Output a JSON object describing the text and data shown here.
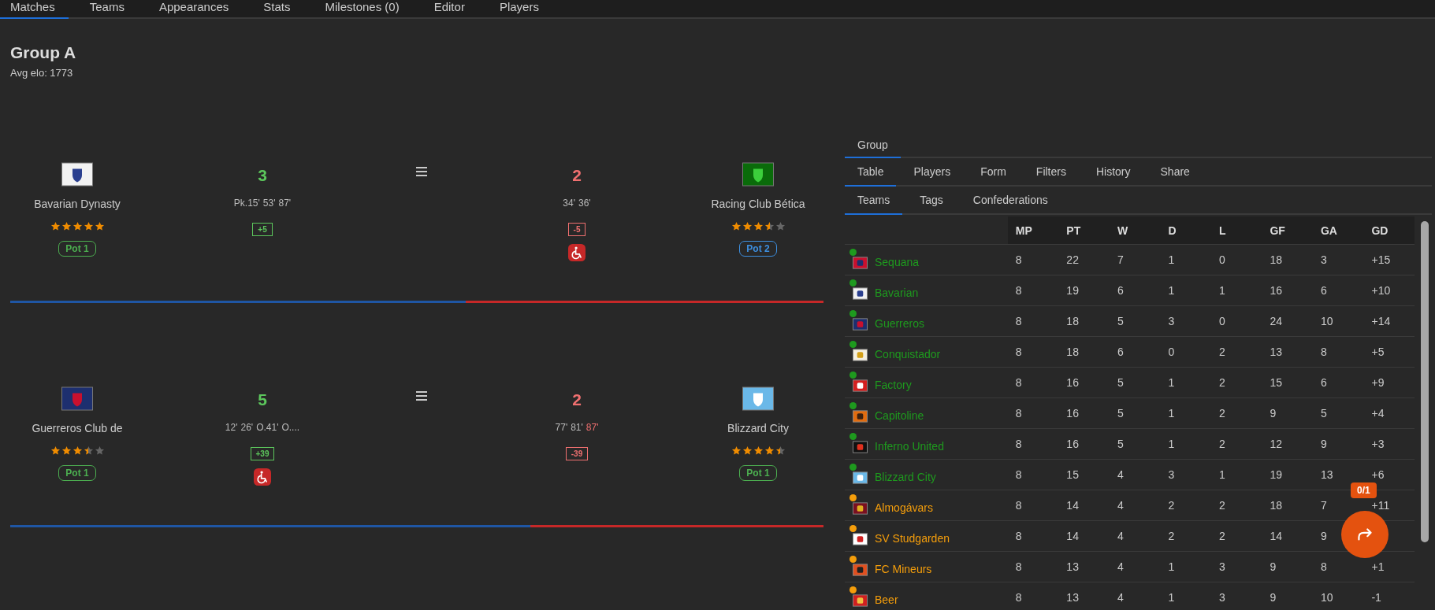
{
  "nav_tabs": [
    {
      "label": "Matches",
      "selected": true
    },
    {
      "label": "Teams",
      "selected": false
    },
    {
      "label": "Appearances",
      "selected": false
    },
    {
      "label": "Stats",
      "selected": false
    },
    {
      "label": "Milestones (0)",
      "selected": false
    },
    {
      "label": "Editor",
      "selected": false
    },
    {
      "label": "Players",
      "selected": false
    }
  ],
  "group": {
    "title": "Group A",
    "subtitle": "Avg elo: 1773"
  },
  "matches": [
    {
      "home": {
        "name": "Bavarian Dynasty",
        "stars": 5,
        "pot": "Pot 1",
        "color": "#4caf50",
        "score": "3",
        "goals": [
          {
            "text": "Pk.15'",
            "highlighted": false
          },
          {
            "text": "53'",
            "highlighted": false
          },
          {
            "text": "87'",
            "highlighted": false
          }
        ],
        "diff": "+5",
        "winner": true,
        "accessibility_badge": false
      },
      "away": {
        "name": "Racing Club Bética",
        "stars": 3.5,
        "pot": "Pot 2",
        "color": "#3d8fe0",
        "score": "2",
        "goals": [
          {
            "text": "34'",
            "highlighted": false
          },
          {
            "text": "36'",
            "highlighted": false
          }
        ],
        "diff": "-5",
        "winner": false,
        "accessibility_badge": true
      },
      "level": 0.56
    },
    {
      "home": {
        "name": "Guerreros Club de",
        "stars": 3.5,
        "pot": "Pot 1",
        "color": "#4caf50",
        "score": "5",
        "goals": [
          {
            "text": "12'",
            "highlighted": false
          },
          {
            "text": "26'",
            "highlighted": false
          },
          {
            "text": "O.41'",
            "highlighted": false
          },
          {
            "text": "O....",
            "highlighted": false
          }
        ],
        "diff": "+39",
        "winner": true,
        "accessibility_badge": true
      },
      "away": {
        "name": "Blizzard City",
        "stars": 4.5,
        "pot": "Pot 1",
        "color": "#4caf50",
        "score": "2",
        "goals": [
          {
            "text": "77'",
            "highlighted": false
          },
          {
            "text": "81'",
            "highlighted": false
          },
          {
            "text": "87'",
            "highlighted": true
          }
        ],
        "diff": "-39",
        "winner": false,
        "accessibility_badge": false
      },
      "level": 0.64
    }
  ],
  "panel_tabs": [
    {
      "label": "Group",
      "selected": true
    }
  ],
  "view_tabs": [
    {
      "label": "Table",
      "selected": true
    },
    {
      "label": "Players",
      "selected": false
    },
    {
      "label": "Form",
      "selected": false
    },
    {
      "label": "Filters",
      "selected": false
    },
    {
      "label": "History",
      "selected": false
    },
    {
      "label": "Share",
      "selected": false
    }
  ],
  "table_tabs": [
    {
      "label": "Teams",
      "selected": true
    },
    {
      "label": "Tags",
      "selected": false
    },
    {
      "label": "Confederations",
      "selected": false
    }
  ],
  "table": {
    "columns": [
      "MP",
      "PT",
      "W",
      "D",
      "L",
      "GF",
      "GA",
      "GD"
    ],
    "rows": [
      {
        "team": "Sequana",
        "color": "#1e9a1e",
        "cells": [
          "8",
          "22",
          "7",
          "1",
          "0",
          "18",
          "3",
          "+15"
        ]
      },
      {
        "team": "Bavarian",
        "color": "#1e9a1e",
        "cells": [
          "8",
          "19",
          "6",
          "1",
          "1",
          "16",
          "6",
          "+10"
        ]
      },
      {
        "team": "Guerreros",
        "color": "#1e9a1e",
        "cells": [
          "8",
          "18",
          "5",
          "3",
          "0",
          "24",
          "10",
          "+14"
        ]
      },
      {
        "team": "Conquistador",
        "color": "#1e9a1e",
        "cells": [
          "8",
          "18",
          "6",
          "0",
          "2",
          "13",
          "8",
          "+5"
        ]
      },
      {
        "team": "Factory",
        "color": "#1e9a1e",
        "cells": [
          "8",
          "16",
          "5",
          "1",
          "2",
          "15",
          "6",
          "+9"
        ]
      },
      {
        "team": "Capitoline",
        "color": "#1e9a1e",
        "cells": [
          "8",
          "16",
          "5",
          "1",
          "2",
          "9",
          "5",
          "+4"
        ]
      },
      {
        "team": "Inferno United",
        "color": "#1e9a1e",
        "cells": [
          "8",
          "16",
          "5",
          "1",
          "2",
          "12",
          "9",
          "+3"
        ]
      },
      {
        "team": "Blizzard City",
        "color": "#1e9a1e",
        "cells": [
          "8",
          "15",
          "4",
          "3",
          "1",
          "19",
          "13",
          "+6"
        ]
      },
      {
        "team": "Almogávars",
        "color": "#f59e0b",
        "cells": [
          "8",
          "14",
          "4",
          "2",
          "2",
          "18",
          "7",
          "+11"
        ]
      },
      {
        "team": "SV Studgarden",
        "color": "#f59e0b",
        "cells": [
          "8",
          "14",
          "4",
          "2",
          "2",
          "14",
          "9"
        ]
      },
      {
        "team": "FC Mineurs",
        "color": "#f59e0b",
        "cells": [
          "8",
          "13",
          "4",
          "1",
          "3",
          "9",
          "8",
          "+1"
        ]
      },
      {
        "team": "Beer",
        "color": "#f59e0b",
        "cells": [
          "8",
          "13",
          "4",
          "1",
          "3",
          "9",
          "10",
          "-1"
        ]
      }
    ]
  },
  "fab": {
    "badge": "0/1"
  }
}
